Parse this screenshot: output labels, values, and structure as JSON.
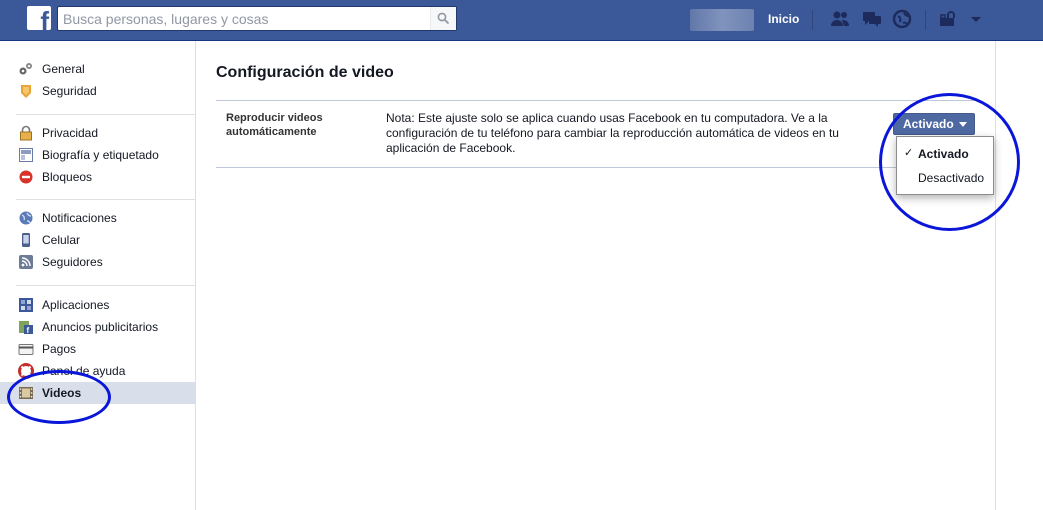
{
  "topbar": {
    "logo_letter": "f",
    "search_placeholder": "Busca personas, lugares y cosas",
    "home_label": "Inicio"
  },
  "leftnav": {
    "groups": [
      [
        {
          "label": "General",
          "icon": "gears-icon"
        },
        {
          "label": "Seguridad",
          "icon": "badge-icon"
        }
      ],
      [
        {
          "label": "Privacidad",
          "icon": "lock-icon"
        },
        {
          "label": "Biografía y etiquetado",
          "icon": "timeline-icon"
        },
        {
          "label": "Bloqueos",
          "icon": "block-icon"
        }
      ],
      [
        {
          "label": "Notificaciones",
          "icon": "globe-icon"
        },
        {
          "label": "Celular",
          "icon": "phone-icon"
        },
        {
          "label": "Seguidores",
          "icon": "rss-icon"
        }
      ],
      [
        {
          "label": "Aplicaciones",
          "icon": "apps-icon"
        },
        {
          "label": "Anuncios publicitarios",
          "icon": "ads-icon"
        },
        {
          "label": "Pagos",
          "icon": "card-icon"
        },
        {
          "label": "Panel de ayuda",
          "icon": "lifebuoy-icon"
        },
        {
          "label": "Videos",
          "icon": "film-icon",
          "selected": true
        }
      ]
    ]
  },
  "main": {
    "title": "Configuración de video",
    "setting_label": "Reproducir videos automáticamente",
    "setting_note": "Nota: Este ajuste solo se aplica cuando usas Facebook en tu computadora. Ve a la configuración de tu teléfono para cambiar la reproducción automática de videos en tu aplicación de Facebook.",
    "dropdown_value": "Activado",
    "dropdown_options": [
      {
        "label": "Activado",
        "checked": true
      },
      {
        "label": "Desactivado",
        "checked": false
      }
    ]
  },
  "colors": {
    "brand": "#3b5998",
    "annotation": "#0a17d8",
    "selected_row": "#d8dfea"
  }
}
